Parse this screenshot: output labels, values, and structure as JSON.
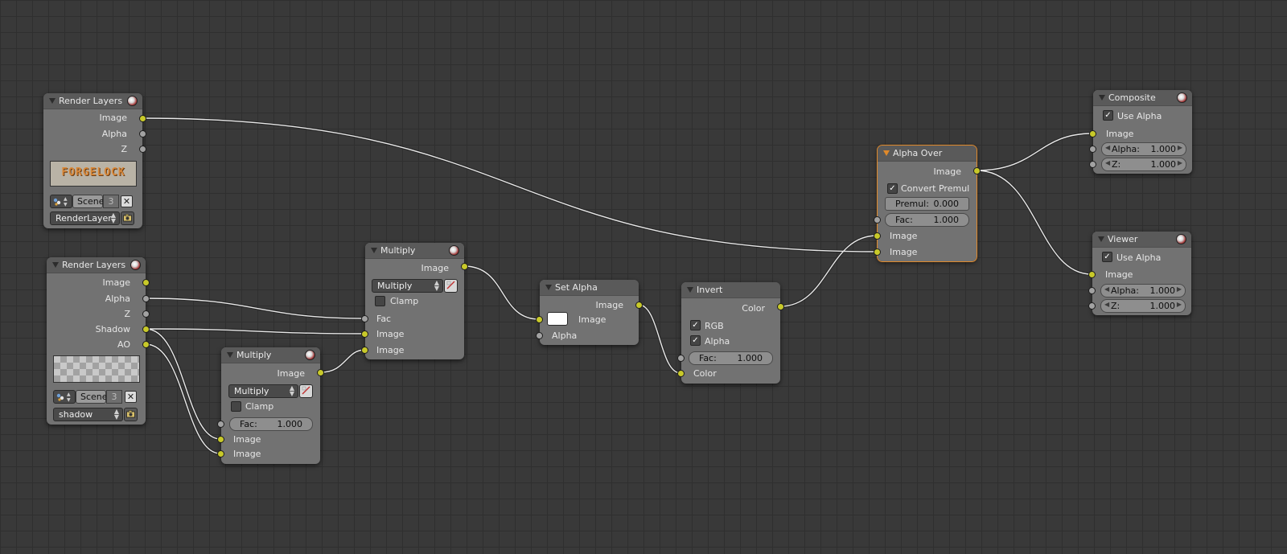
{
  "nodes": {
    "render_layers_1": {
      "title": "Render Layers",
      "outputs": [
        "Image",
        "Alpha",
        "Z"
      ],
      "preview_text": "FORGELOCK",
      "scene_label": "Scene",
      "scene_users": "3",
      "layer_value": "RenderLayer"
    },
    "render_layers_2": {
      "title": "Render Layers",
      "outputs": [
        "Image",
        "Alpha",
        "Z",
        "Shadow",
        "AO"
      ],
      "scene_label": "Scene",
      "scene_users": "3",
      "layer_value": "shadow"
    },
    "multiply_1": {
      "title": "Multiply",
      "output": "Image",
      "blend_mode": "Multiply",
      "clamp_label": "Clamp",
      "inputs": [
        "Fac",
        "Image",
        "Image"
      ]
    },
    "multiply_2": {
      "title": "Multiply",
      "output": "Image",
      "blend_mode": "Multiply",
      "clamp_label": "Clamp",
      "fac_label": "Fac:",
      "fac_value": "1.000",
      "inputs": [
        "Image",
        "Image"
      ]
    },
    "set_alpha": {
      "title": "Set Alpha",
      "output": "Image",
      "inputs": [
        "Image",
        "Alpha"
      ]
    },
    "invert": {
      "title": "Invert",
      "output": "Color",
      "rgb_label": "RGB",
      "alpha_label": "Alpha",
      "fac_label": "Fac:",
      "fac_value": "1.000",
      "input": "Color"
    },
    "alpha_over": {
      "title": "Alpha Over",
      "output": "Image",
      "convert_label": "Convert Premul",
      "premul_label": "Premul:",
      "premul_value": "0.000",
      "fac_label": "Fac:",
      "fac_value": "1.000",
      "inputs": [
        "Image",
        "Image"
      ]
    },
    "composite": {
      "title": "Composite",
      "use_alpha_label": "Use Alpha",
      "input": "Image",
      "alpha_label": "Alpha:",
      "alpha_value": "1.000",
      "z_label": "Z:",
      "z_value": "1.000"
    },
    "viewer": {
      "title": "Viewer",
      "use_alpha_label": "Use Alpha",
      "input": "Image",
      "alpha_label": "Alpha:",
      "alpha_value": "1.000",
      "z_label": "Z:",
      "z_value": "1.000"
    }
  },
  "colors": {
    "background": "#393939",
    "grid": "#2f2f2f",
    "node_body": "#727272",
    "node_header": "#5a5a5a",
    "socket_color": "#c8c92a",
    "socket_value": "#a2a2a2",
    "link": "#e8e8e8",
    "active_outline": "#e0892a"
  },
  "icons": {
    "collapse": "triangle-down-icon",
    "preview": "render-preview-sphere-icon",
    "scene": "scene-icon",
    "close": "x-icon",
    "camera": "camera-icon",
    "color_ramp": "color-picker-icon"
  }
}
